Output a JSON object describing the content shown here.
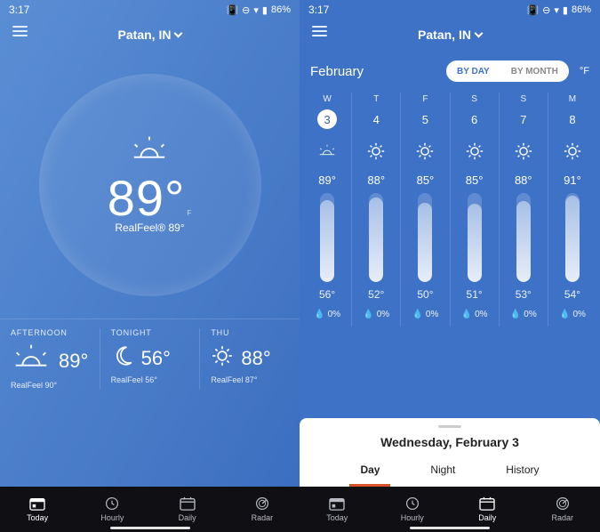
{
  "status": {
    "time": "3:17",
    "battery": "86%"
  },
  "left": {
    "location": "Patan, IN",
    "current_temp": "89°",
    "realfeel": "RealFeel® 89°",
    "forecast": [
      {
        "label": "AFTERNOON",
        "temp": "89°",
        "rf": "RealFeel 90°",
        "icon": "sunset"
      },
      {
        "label": "TONIGHT",
        "temp": "56°",
        "rf": "RealFeel 56°",
        "icon": "moon"
      },
      {
        "label": "THU",
        "temp": "88°",
        "rf": "RealFeel 87°",
        "icon": "sun"
      }
    ],
    "nav": [
      {
        "label": "Today",
        "icon": "today",
        "active": true
      },
      {
        "label": "Hourly",
        "icon": "hourly",
        "active": false
      },
      {
        "label": "Daily",
        "icon": "daily",
        "active": false
      },
      {
        "label": "Radar",
        "icon": "radar",
        "active": false
      }
    ]
  },
  "right": {
    "location": "Patan, IN",
    "month": "February",
    "toggle": {
      "left": "BY DAY",
      "right": "BY MONTH",
      "active": "left"
    },
    "unit": "°F",
    "days": [
      {
        "dow": "W",
        "num": "3",
        "selected": true,
        "icon": "sunset",
        "hi": "89°",
        "lo": "56°",
        "prec": "0%",
        "bar": 92
      },
      {
        "dow": "T",
        "num": "4",
        "selected": false,
        "icon": "sun",
        "hi": "88°",
        "lo": "52°",
        "prec": "0%",
        "bar": 95
      },
      {
        "dow": "F",
        "num": "5",
        "selected": false,
        "icon": "sun",
        "hi": "85°",
        "lo": "50°",
        "prec": "0%",
        "bar": 89
      },
      {
        "dow": "S",
        "num": "6",
        "selected": false,
        "icon": "sun",
        "hi": "85°",
        "lo": "51°",
        "prec": "0%",
        "bar": 88
      },
      {
        "dow": "S",
        "num": "7",
        "selected": false,
        "icon": "sun",
        "hi": "88°",
        "lo": "53°",
        "prec": "0%",
        "bar": 91
      },
      {
        "dow": "M",
        "num": "8",
        "selected": false,
        "icon": "sun",
        "hi": "91°",
        "lo": "54°",
        "prec": "0%",
        "bar": 97
      }
    ],
    "sheet": {
      "title": "Wednesday, February 3",
      "tabs": [
        {
          "label": "Day",
          "active": true
        },
        {
          "label": "Night",
          "active": false
        },
        {
          "label": "History",
          "active": false
        }
      ]
    },
    "nav": [
      {
        "label": "Today",
        "icon": "today",
        "active": false
      },
      {
        "label": "Hourly",
        "icon": "hourly",
        "active": false
      },
      {
        "label": "Daily",
        "icon": "daily",
        "active": true
      },
      {
        "label": "Radar",
        "icon": "radar",
        "active": false
      }
    ]
  }
}
